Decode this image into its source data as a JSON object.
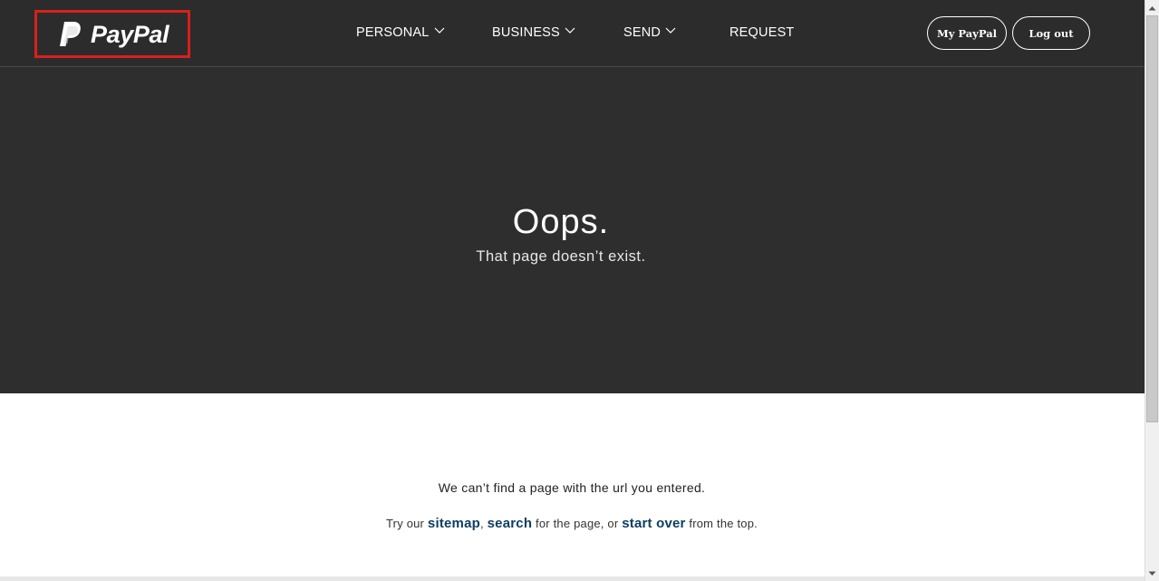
{
  "header": {
    "logo_text": "PayPal",
    "nav": [
      {
        "label": "PERSONAL",
        "has_dropdown": true
      },
      {
        "label": "BUSINESS",
        "has_dropdown": true
      },
      {
        "label": "SEND",
        "has_dropdown": true
      },
      {
        "label": "REQUEST",
        "has_dropdown": false
      }
    ],
    "my_paypal_label": "My PayPal",
    "logout_label": "Log out"
  },
  "hero": {
    "title": "Oops.",
    "subtitle": "That page doesn’t exist."
  },
  "content": {
    "message": "We can’t find a page with the url you entered.",
    "try_prefix": "Try our",
    "sitemap_link": "sitemap",
    "comma": ",",
    "search_link": "search",
    "middle": "for the page, or",
    "start_over_link": "start over",
    "suffix": "from the top."
  },
  "colors": {
    "header_bg": "#2c2c2c",
    "hero_bg": "#2e2e2e",
    "highlight_border": "#d9201c",
    "link": "#0e3e62"
  },
  "icons": [
    "paypal-logo-icon",
    "chevron-down-icon",
    "scroll-up-icon",
    "scroll-down-icon"
  ]
}
